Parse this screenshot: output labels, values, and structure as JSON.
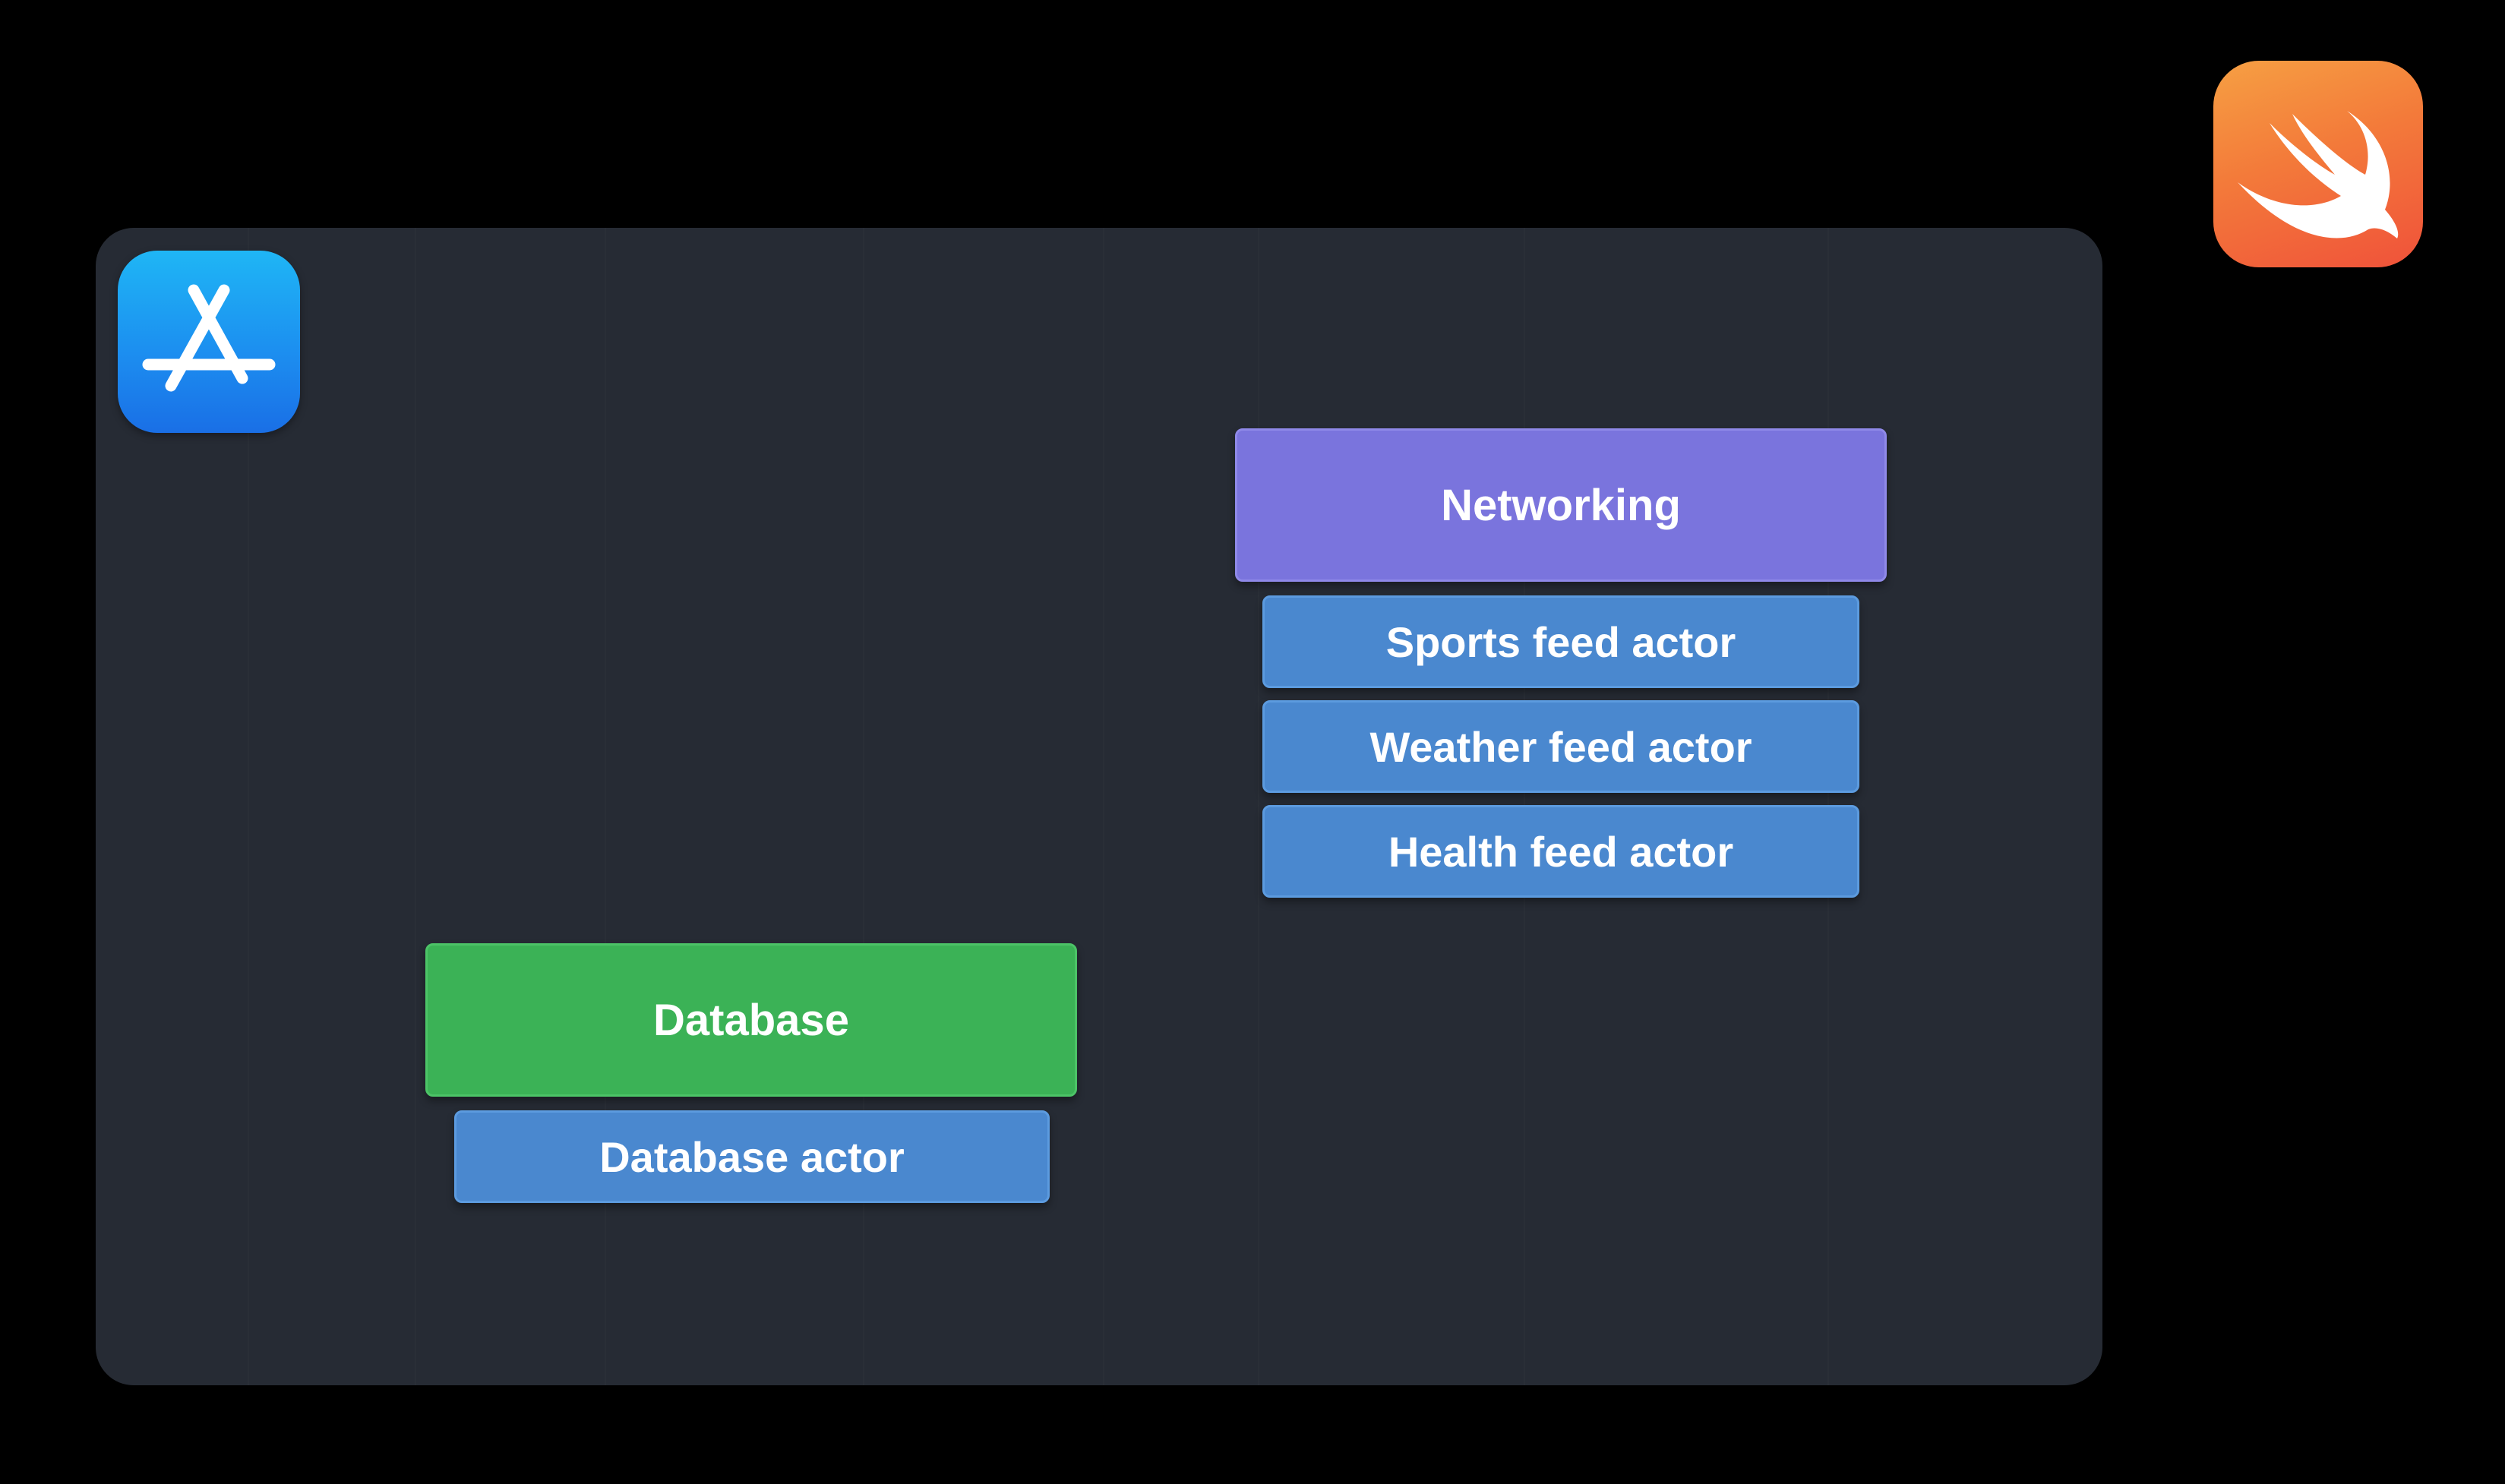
{
  "diagram": {
    "app_icon": "app-store-icon",
    "swift_icon": "swift-logo-icon",
    "groups": [
      {
        "title": "Networking",
        "color": "#7a74dd",
        "border": "#8f89e8",
        "actors": [
          "Sports feed actor",
          "Weather feed actor",
          "Health feed actor"
        ]
      },
      {
        "title": "Database",
        "color": "#3bb256",
        "border": "#4cc467",
        "actors": [
          "Database actor"
        ]
      }
    ],
    "actor_color": "#4a88cf"
  }
}
